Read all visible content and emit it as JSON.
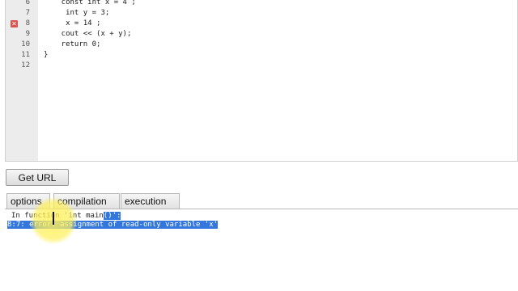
{
  "editor": {
    "lines": [
      {
        "num": "6",
        "code": "    const int x = 4 ;",
        "error": false
      },
      {
        "num": "7",
        "code": "     int y = 3;",
        "error": false
      },
      {
        "num": "8",
        "code": "     x = 14 ;",
        "error": true
      },
      {
        "num": "9",
        "code": "    cout << (x + y);",
        "error": false
      },
      {
        "num": "10",
        "code": "    return 0;",
        "error": false
      },
      {
        "num": "11",
        "code": "}",
        "error": false
      },
      {
        "num": "12",
        "code": "",
        "error": false
      }
    ],
    "error_marker": "✕"
  },
  "toolbar": {
    "get_url_label": "Get URL"
  },
  "tabs": [
    {
      "label": "options"
    },
    {
      "label": "compilation"
    },
    {
      "label": "execution"
    }
  ],
  "console": {
    "line1_pre": "In function 'int main",
    "line1_sel": "()':",
    "line2": "8:7: error: assignment of read-only variable 'x'"
  }
}
